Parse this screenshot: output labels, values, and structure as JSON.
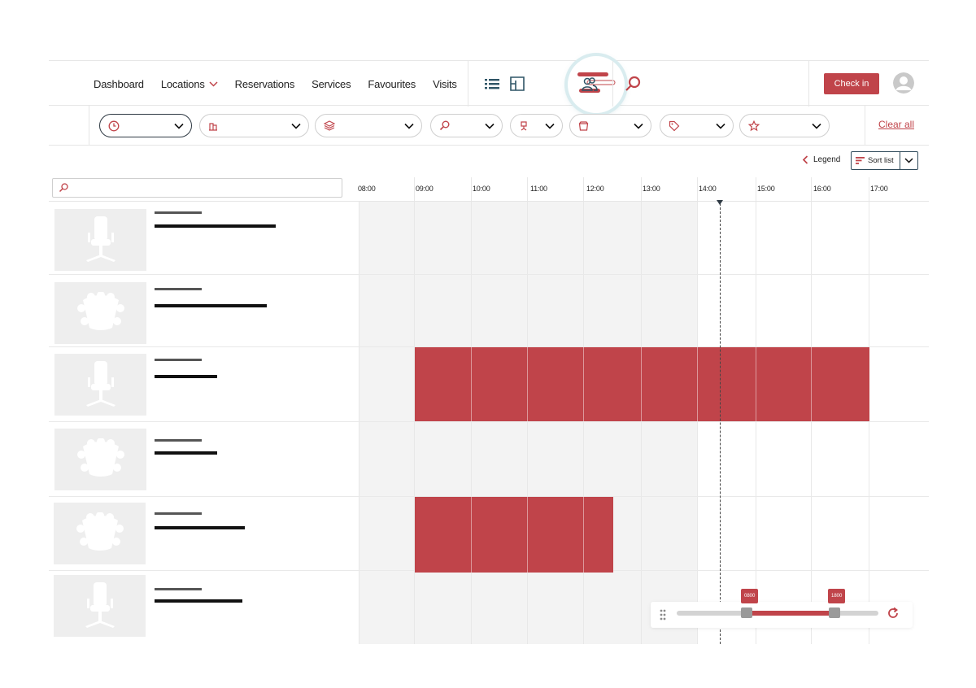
{
  "nav": {
    "links": [
      {
        "label": "Dashboard"
      },
      {
        "label": "Locations"
      },
      {
        "label": "Reservations"
      },
      {
        "label": "Services"
      },
      {
        "label": "Favourites"
      },
      {
        "label": "Visits"
      }
    ],
    "icons": [
      "list-view-icon",
      "floorplan-icon",
      "people-icon",
      "search-icon"
    ],
    "check_in_label": "Check in"
  },
  "filters": {
    "items": [
      {
        "icon": "clock-icon"
      },
      {
        "icon": "building-icon"
      },
      {
        "icon": "layers-icon"
      },
      {
        "icon": "search-icon"
      },
      {
        "icon": "desk-chair-icon"
      },
      {
        "icon": "room-icon"
      },
      {
        "icon": "tag-icon"
      },
      {
        "icon": "star-icon"
      }
    ],
    "clear_all_label": "Clear all"
  },
  "toolbar": {
    "legend_label": "Legend",
    "sort_label": "Sort list"
  },
  "timeline": {
    "search_placeholder": "",
    "hours": [
      "08:00",
      "09:00",
      "10:00",
      "11:00",
      "12:00",
      "13:00",
      "14:00",
      "15:00",
      "16:00",
      "17:00"
    ],
    "rows": [
      {
        "type": "desk",
        "reservations": []
      },
      {
        "type": "meeting-room",
        "reservations": []
      },
      {
        "type": "desk",
        "reservations": [
          {
            "start": "09:00",
            "end": "17:00"
          }
        ]
      },
      {
        "type": "meeting-room",
        "reservations": []
      },
      {
        "type": "meeting-room",
        "reservations": [
          {
            "start": "09:00",
            "end": "12:30"
          }
        ]
      },
      {
        "type": "desk",
        "reservations": []
      }
    ]
  },
  "range": {
    "start_label": "0800",
    "end_label": "1800"
  },
  "colors": {
    "accent": "#c0444a",
    "nav_icon": "#2f5566",
    "logo_ring": "#d9ecef"
  }
}
